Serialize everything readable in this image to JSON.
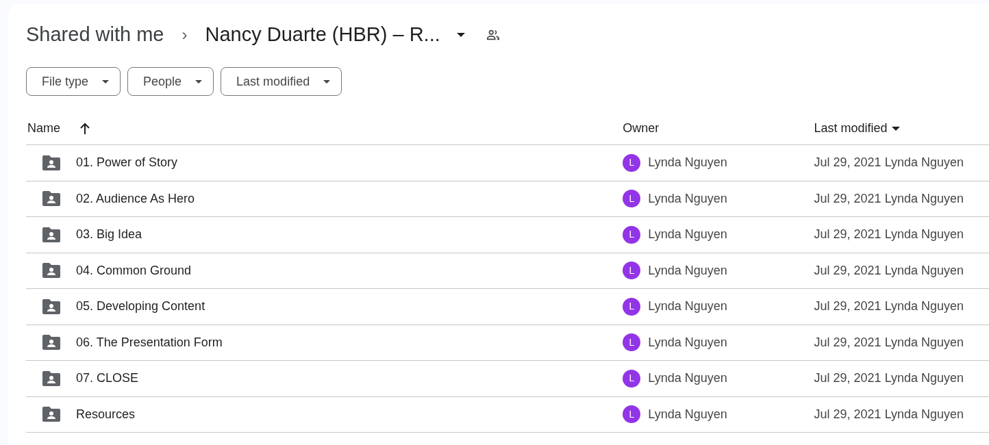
{
  "breadcrumb": {
    "root": "Shared with me",
    "separator": "›",
    "current": "Nancy Duarte (HBR) – R..."
  },
  "filters": [
    {
      "label": "File type"
    },
    {
      "label": "People"
    },
    {
      "label": "Last modified"
    }
  ],
  "table": {
    "columns": [
      {
        "label": "Name",
        "kind": "arrow",
        "sorted": true,
        "descending": false
      },
      {
        "label": "Owner",
        "sorted": false
      },
      {
        "label": "Last modified",
        "kind": "caret",
        "sorted": true,
        "descending": true
      }
    ],
    "rows": [
      {
        "name": "01. Power of Story",
        "owner_initial": "L",
        "owner": "Lynda Nguyen",
        "color": "#9334e6",
        "modified": "Jul 29, 2021 Lynda Nguyen"
      },
      {
        "name": "02. Audience As Hero",
        "owner_initial": "L",
        "owner": "Lynda Nguyen",
        "color": "#9334e6",
        "modified": "Jul 29, 2021 Lynda Nguyen"
      },
      {
        "name": "03. Big Idea",
        "owner_initial": "L",
        "owner": "Lynda Nguyen",
        "color": "#9334e6",
        "modified": "Jul 29, 2021 Lynda Nguyen"
      },
      {
        "name": "04. Common Ground",
        "owner_initial": "L",
        "owner": "Lynda Nguyen",
        "color": "#9334e6",
        "modified": "Jul 29, 2021 Lynda Nguyen"
      },
      {
        "name": "05. Developing Content",
        "owner_initial": "L",
        "owner": "Lynda Nguyen",
        "color": "#9334e6",
        "modified": "Jul 29, 2021 Lynda Nguyen"
      },
      {
        "name": "06. The Presentation Form",
        "owner_initial": "L",
        "owner": "Lynda Nguyen",
        "color": "#9334e6",
        "modified": "Jul 29, 2021 Lynda Nguyen"
      },
      {
        "name": "07. CLOSE",
        "owner_initial": "L",
        "owner": "Lynda Nguyen",
        "color": "#9334e6",
        "modified": "Jul 29, 2021 Lynda Nguyen"
      },
      {
        "name": "Resources",
        "owner_initial": "L",
        "owner": "Lynda Nguyen",
        "color": "#9334e6",
        "modified": "Jul 29, 2021 Lynda Nguyen"
      }
    ]
  }
}
